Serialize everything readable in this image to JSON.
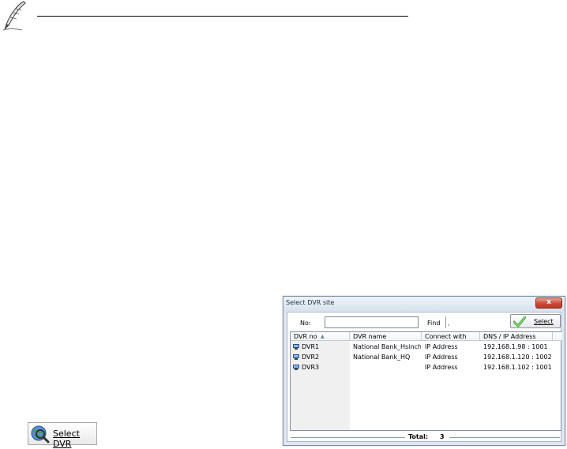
{
  "note": {
    "icon": "pen-icon"
  },
  "dialog": {
    "title": "Select DVR site",
    "close_label": "x",
    "no_label": "No:",
    "no_value": "",
    "find_label": "Find",
    "find_arrow": ",",
    "select_label": "Select",
    "columns": [
      "DVR no",
      "DVR name",
      "Connect with",
      "DNS / IP Address"
    ],
    "sort_indicator": "▲",
    "rows": [
      {
        "no": "DVR1",
        "name": "National Bank_Hsinch…",
        "connect": "IP Address",
        "address": "192.168.1.98 : 1001"
      },
      {
        "no": "DVR2",
        "name": "National Bank_HQ",
        "connect": "IP Address",
        "address": "192.168.1.120 : 1002"
      },
      {
        "no": "DVR3",
        "name": "",
        "connect": "IP Address",
        "address": "192.168.1.102 : 1001"
      }
    ],
    "total_label": "Total:",
    "total_value": "3"
  },
  "select_dvr_button": {
    "label": "Select DVR",
    "icon": "globe-search-icon"
  },
  "colors": {
    "accent": "#3fa535",
    "title_text": "#1e2f44",
    "close": "#c94b35"
  }
}
